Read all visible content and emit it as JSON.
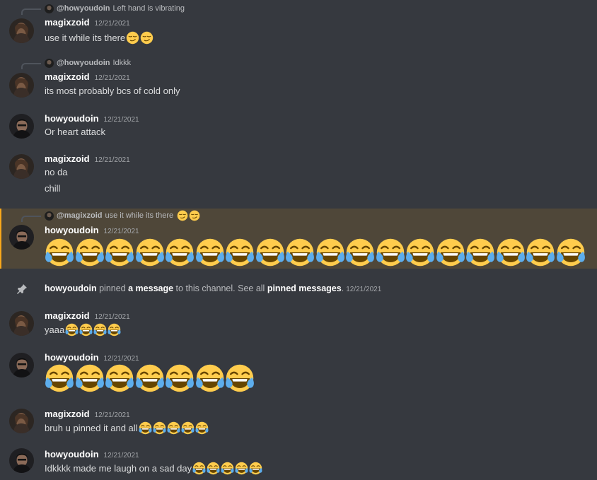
{
  "colors": {
    "background": "#36393f",
    "highlight_bar": "#faa81a",
    "author": "#ffffff",
    "text": "#dcddde",
    "muted": "#a3a6aa"
  },
  "messages": [
    {
      "reply": {
        "author": "@howyoudoin",
        "text": "Left hand is vibrating"
      },
      "author": "magixzoid",
      "timestamp": "12/21/2021",
      "avatar": "magixzoid-avatar",
      "lines": [
        {
          "text": "use it while its there",
          "emoji": "smirk-emoji",
          "emoji_count": 2
        }
      ]
    },
    {
      "reply": {
        "author": "@howyoudoin",
        "text": "Idkkk"
      },
      "author": "magixzoid",
      "timestamp": "12/21/2021",
      "avatar": "magixzoid-avatar",
      "lines": [
        {
          "text": "its most probably bcs of cold only"
        }
      ]
    },
    {
      "author": "howyoudoin",
      "timestamp": "12/21/2021",
      "avatar": "howyoudoin-avatar",
      "lines": [
        {
          "text": "Or heart attack"
        }
      ]
    },
    {
      "author": "magixzoid",
      "timestamp": "12/21/2021",
      "avatar": "magixzoid-avatar",
      "lines": [
        {
          "text": "no da"
        },
        {
          "text": "chill"
        }
      ]
    },
    {
      "highlighted": true,
      "reply": {
        "author": "@magixzoid",
        "text": "use it while its there",
        "emoji": "smirk-emoji",
        "emoji_count": 2
      },
      "author": "howyoudoin",
      "timestamp": "12/21/2021",
      "avatar": "howyoudoin-avatar",
      "lines": [
        {
          "text": "",
          "emoji": "joy-emoji",
          "emoji_count": 18,
          "jumbo": true
        }
      ]
    },
    {
      "system": true,
      "icon": "pin-icon",
      "actor": "howyoudoin",
      "part1": "pinned",
      "link1": "a message",
      "part2": "to this channel. See all",
      "link2": "pinned messages",
      "part3": ".",
      "timestamp": "12/21/2021"
    },
    {
      "author": "magixzoid",
      "timestamp": "12/21/2021",
      "avatar": "magixzoid-avatar",
      "lines": [
        {
          "text": "yaaa",
          "emoji": "joy-emoji",
          "emoji_count": 4
        }
      ]
    },
    {
      "author": "howyoudoin",
      "timestamp": "12/21/2021",
      "avatar": "howyoudoin-avatar",
      "lines": [
        {
          "text": "",
          "emoji": "joy-emoji",
          "emoji_count": 7,
          "jumbo": true
        }
      ]
    },
    {
      "author": "magixzoid",
      "timestamp": "12/21/2021",
      "avatar": "magixzoid-avatar",
      "lines": [
        {
          "text": "bruh u pinned it and all",
          "emoji": "joy-emoji",
          "emoji_count": 5
        }
      ]
    },
    {
      "author": "howyoudoin",
      "timestamp": "12/21/2021",
      "avatar": "howyoudoin-avatar",
      "lines": [
        {
          "text": "Idkkkk made me laugh on a sad day",
          "emoji": "joy-emoji",
          "emoji_count": 5
        }
      ]
    }
  ]
}
